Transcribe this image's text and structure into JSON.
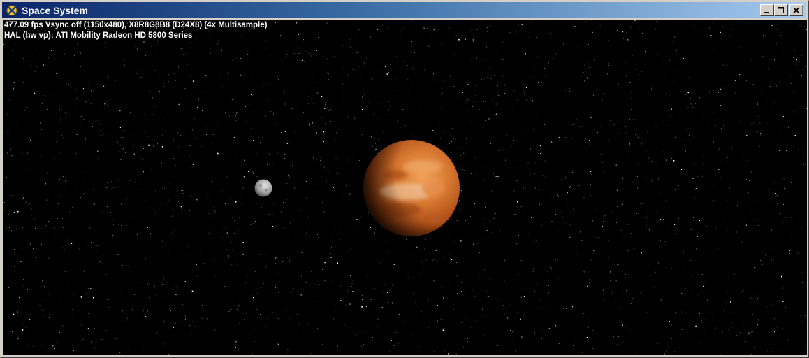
{
  "window": {
    "title": "Space System",
    "buttons": {
      "minimize": "minimize",
      "maximize": "maximize",
      "close": "close"
    }
  },
  "overlay": {
    "stats_line_1": "477.09 fps Vsync off (1150x480), X8R8G8B8 (D24X8) (4x Multisample)",
    "stats_line_2": "HAL (hw vp): ATI Mobility Radeon HD 5800 Series"
  },
  "scene": {
    "background_color": "#000000",
    "planet_color": "#c8621e",
    "moon_color": "#9a9a9a"
  },
  "colors": {
    "titlebar_start": "#0a246a",
    "titlebar_end": "#a6caf0",
    "chrome": "#d4d0c8"
  }
}
